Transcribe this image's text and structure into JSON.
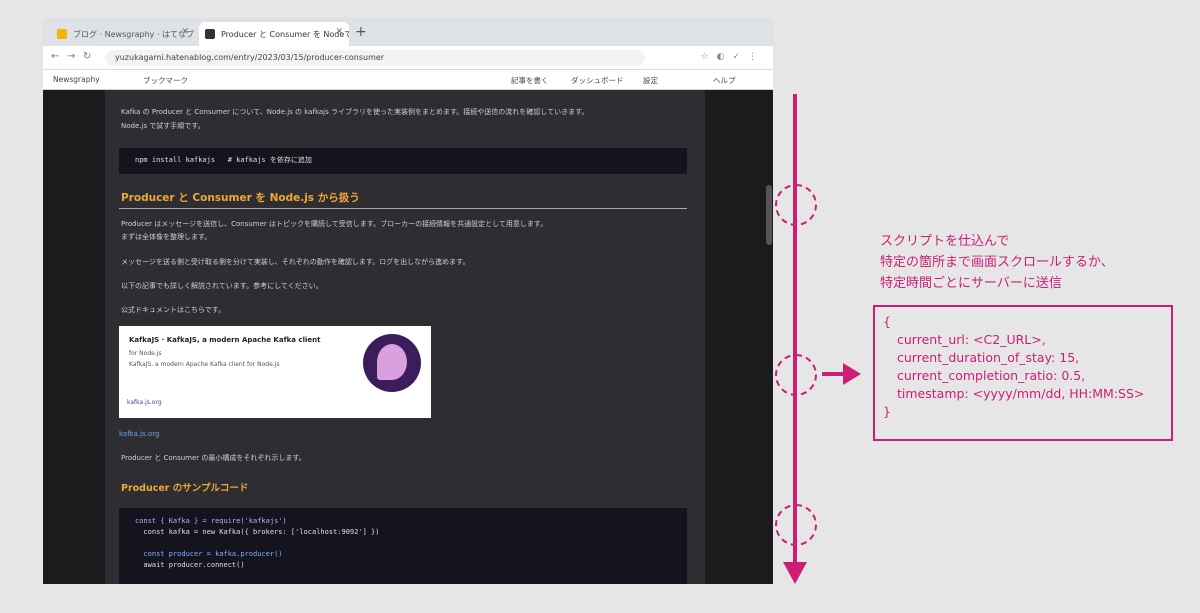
{
  "browser": {
    "tabs": [
      {
        "label": "ブログ · Newsgraphy · はてなブログ",
        "favicon_color": "#f2b705"
      },
      {
        "label": "Producer と Consumer を Nodeで実装",
        "favicon_color": "#333333"
      }
    ],
    "url": "yuzukagami.hatenablog.com/entry/2023/03/15/producer-consumer",
    "bookmarks": [
      "Newsgraphy",
      "ブックマーク",
      "記事を書く",
      "ダッシュボード",
      "設定",
      "ヘルプ"
    ]
  },
  "article": {
    "intro_line1": "Kafka の Producer と Consumer について、Node.js の kafkajs ライブラリを使った実装例をまとめます。接続や送信の流れを確認していきます。",
    "intro_line2": "Node.js で試す手順です。",
    "code1": "npm install kafkajs   # kafkajs を依存に追加",
    "heading1": "Producer と Consumer を Node.js から扱う",
    "para1_line1": "Producer はメッセージを送信し、Consumer はトピックを購読して受信します。ブローカーの接続情報を共通設定として用意します。",
    "para1_line2": "まずは全体像を整理します。",
    "para2": "メッセージを送る側と受け取る側を分けて実装し、それぞれの動作を確認します。ログを出しながら進めます。",
    "para3": "以下の記事でも詳しく解説されています。参考にしてください。",
    "para4": "公式ドキュメントはこちらです。",
    "card": {
      "title": "KafkaJS · KafkaJS, a modern Apache Kafka client",
      "line1": "for Node.js",
      "line2": "KafkaJS, a modern Apache Kafka client for Node.js",
      "footer": "kafka.js.org"
    },
    "link": "kafka.js.org",
    "para5": "Producer と Consumer の最小構成をそれぞれ示します。",
    "heading2": "Producer のサンプルコード",
    "code2": [
      "const { Kafka } = require('kafkajs')",
      "  const kafka = new Kafka({ brokers: ['localhost:9092'] })",
      "",
      "  const producer = kafka.producer()",
      "  await producer.connect()"
    ]
  },
  "annotation": {
    "note_lines": [
      "スクリプトを仕込んで",
      "特定の箇所まで画面スクロールするか、",
      "特定時間ごとにサーバーに送信"
    ],
    "payload": {
      "open": "{",
      "lines": [
        "current_url: <C2_URL>,",
        "current_duration_of_stay: 15,",
        "current_completion_ratio: 0.5,",
        "timestamp: <yyyy/mm/dd, HH:MM:SS>"
      ],
      "close": "}"
    },
    "accent_color": "#cc1e75"
  }
}
